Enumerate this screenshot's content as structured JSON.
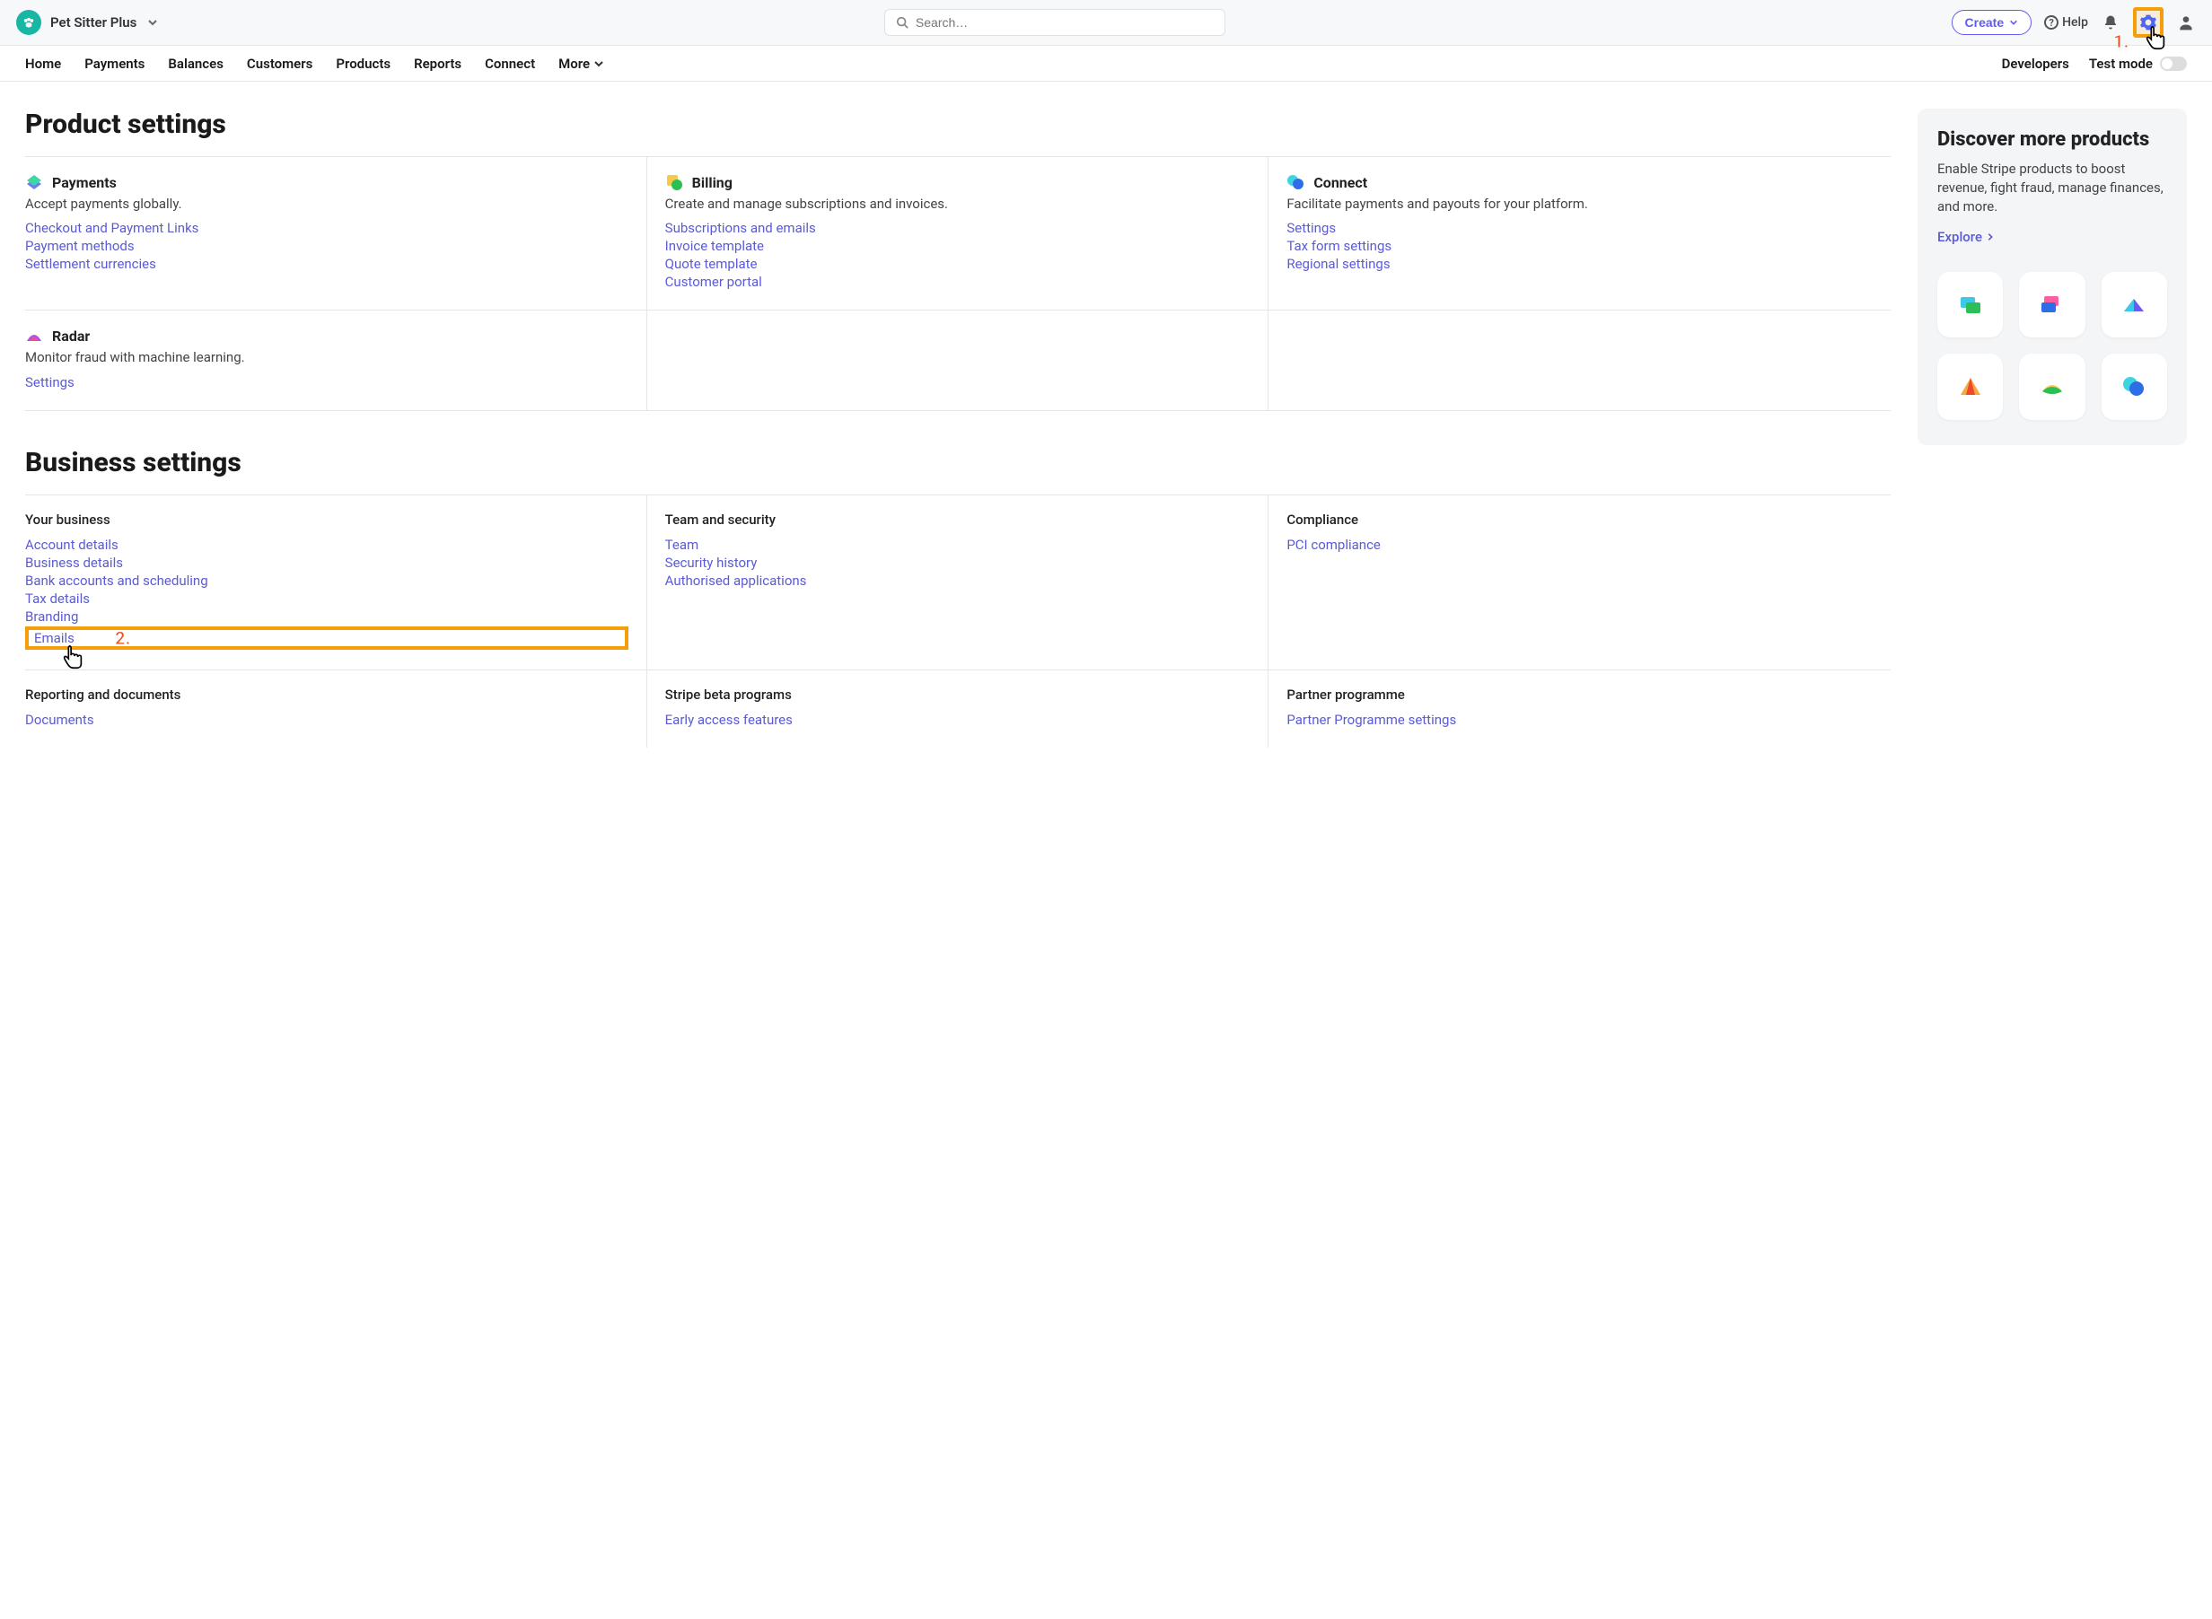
{
  "topbar": {
    "brand_name": "Pet Sitter Plus",
    "search_placeholder": "Search…",
    "create_label": "Create",
    "help_label": "Help"
  },
  "annotations": {
    "step1": "1.",
    "step2": "2."
  },
  "nav": {
    "items": [
      "Home",
      "Payments",
      "Balances",
      "Customers",
      "Products",
      "Reports",
      "Connect",
      "More"
    ],
    "developers": "Developers",
    "test_mode": "Test mode"
  },
  "sections": {
    "product_settings_title": "Product settings",
    "business_settings_title": "Business settings"
  },
  "products": {
    "payments": {
      "title": "Payments",
      "desc": "Accept payments globally.",
      "links": [
        "Checkout and Payment Links",
        "Payment methods",
        "Settlement currencies"
      ]
    },
    "billing": {
      "title": "Billing",
      "desc": "Create and manage subscriptions and invoices.",
      "links": [
        "Subscriptions and emails",
        "Invoice template",
        "Quote template",
        "Customer portal"
      ]
    },
    "connect": {
      "title": "Connect",
      "desc": "Facilitate payments and payouts for your platform.",
      "links": [
        "Settings",
        "Tax form settings",
        "Regional settings"
      ]
    },
    "radar": {
      "title": "Radar",
      "desc": "Monitor fraud with machine learning.",
      "links": [
        "Settings"
      ]
    }
  },
  "business": {
    "your_business": {
      "title": "Your business",
      "links": [
        "Account details",
        "Business details",
        "Bank accounts and scheduling",
        "Tax details",
        "Branding",
        "Emails"
      ]
    },
    "team_security": {
      "title": "Team and security",
      "links": [
        "Team",
        "Security history",
        "Authorised applications"
      ]
    },
    "compliance": {
      "title": "Compliance",
      "links": [
        "PCI compliance"
      ]
    },
    "reporting": {
      "title": "Reporting and documents",
      "links": [
        "Documents"
      ]
    },
    "beta": {
      "title": "Stripe beta programs",
      "links": [
        "Early access features"
      ]
    },
    "partner": {
      "title": "Partner programme",
      "links": [
        "Partner Programme settings"
      ]
    }
  },
  "discover": {
    "title": "Discover more products",
    "desc": "Enable Stripe products to boost revenue, fight fraud, manage finances, and more.",
    "explore": "Explore"
  }
}
